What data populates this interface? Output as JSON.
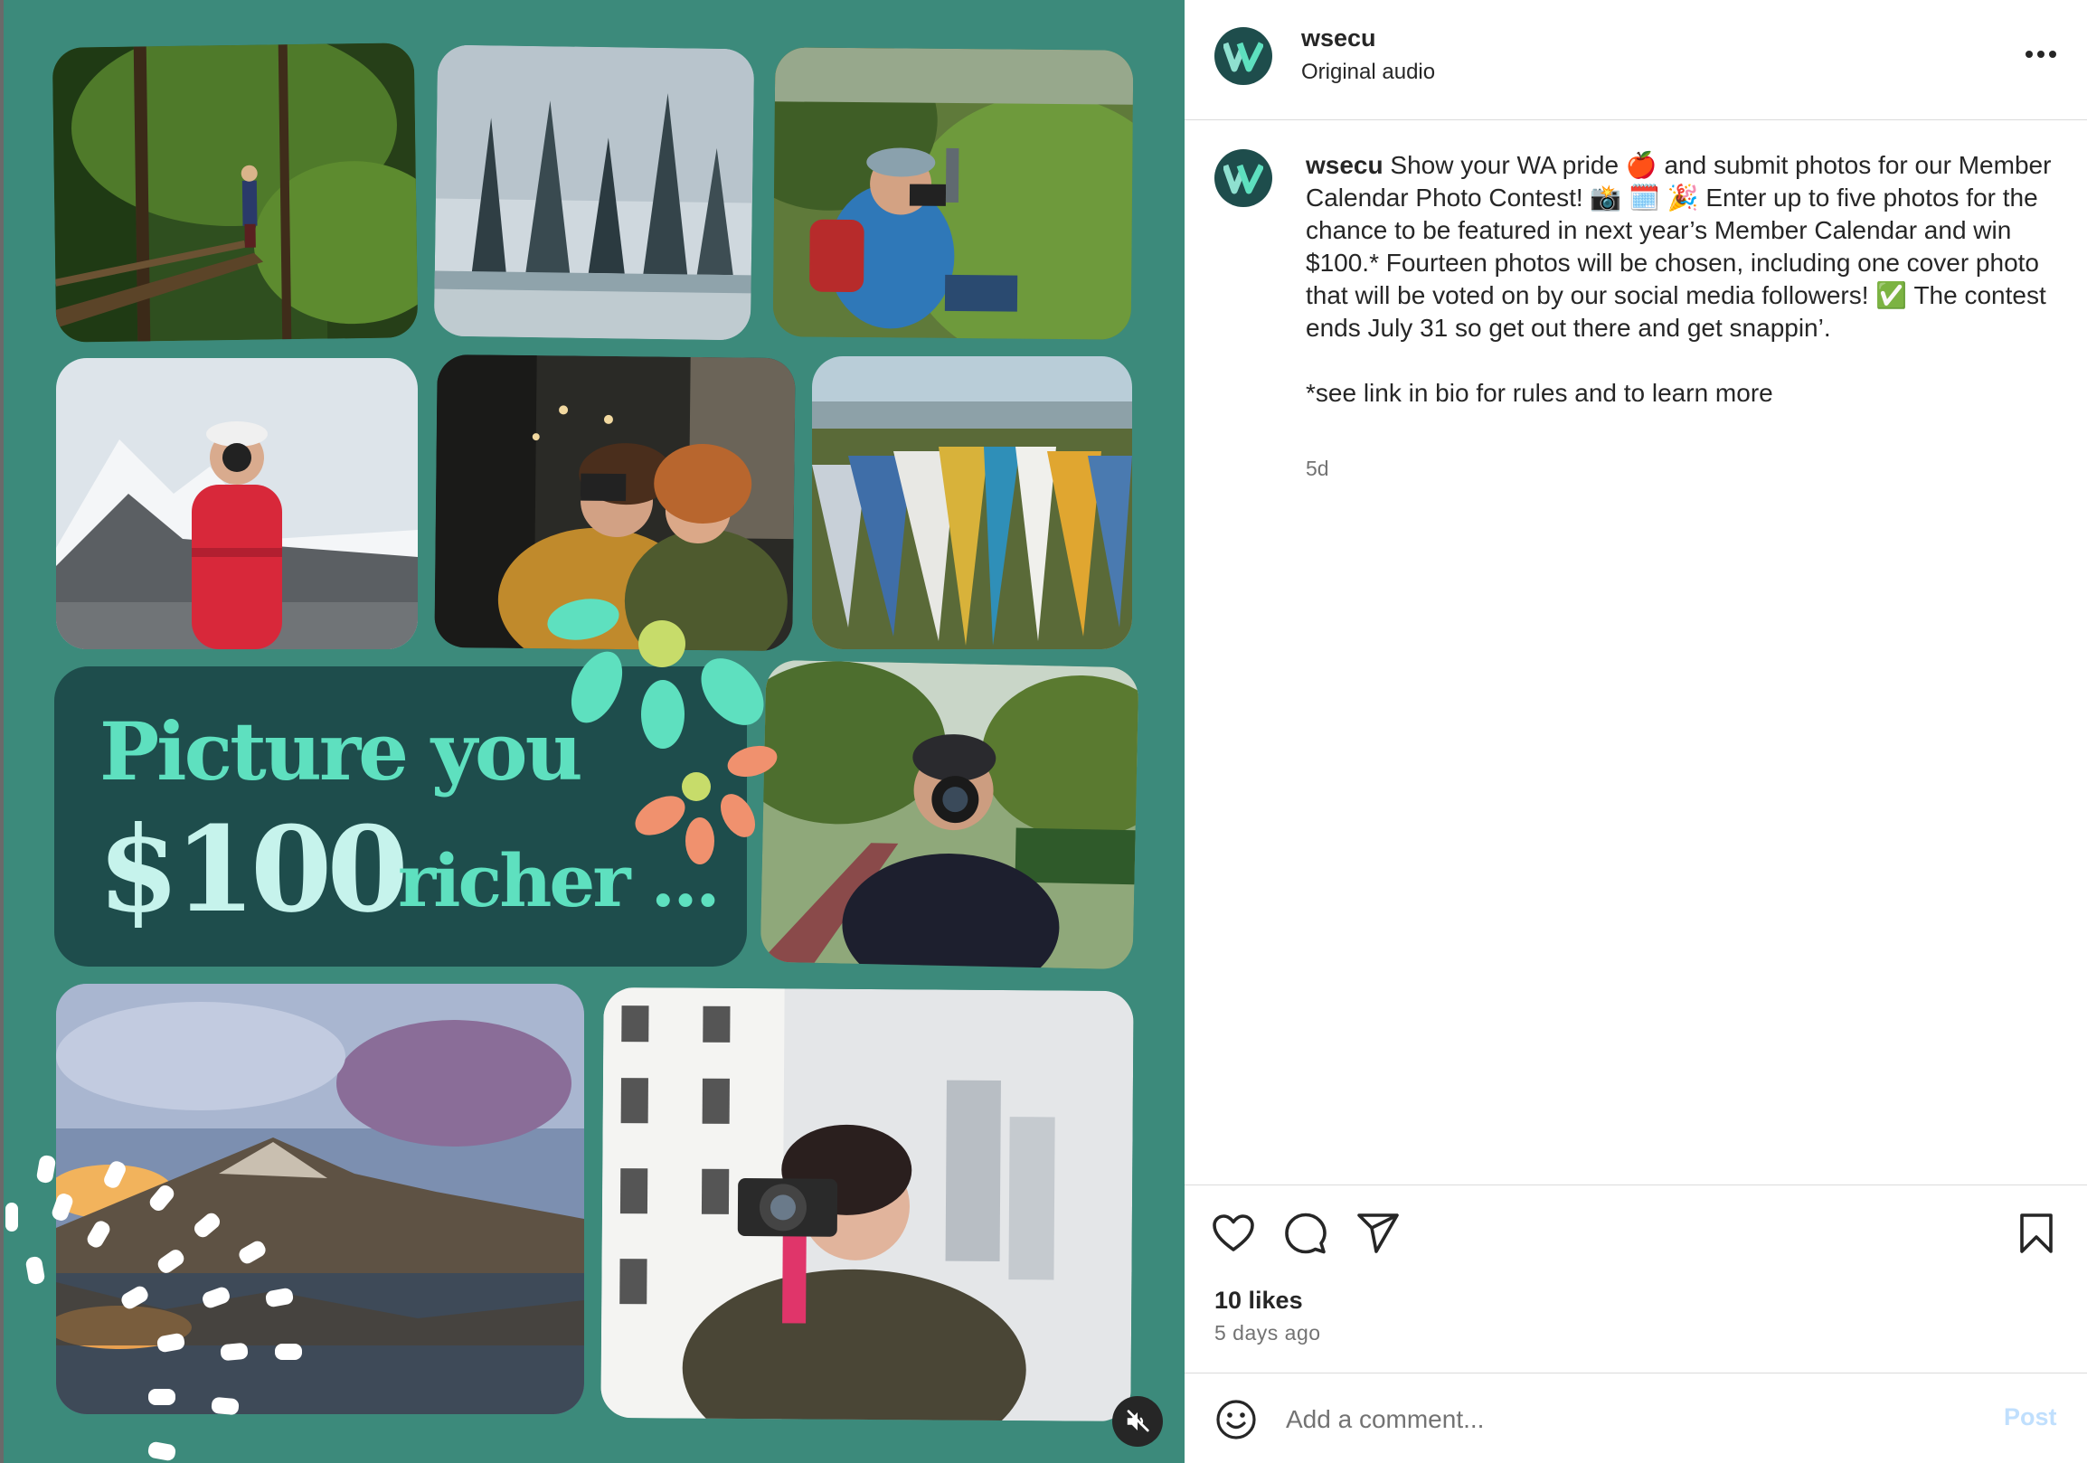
{
  "post": {
    "username": "wsecu",
    "audio": "Original audio",
    "avatar_letter": "W"
  },
  "media": {
    "headline_line1": "Picture you",
    "headline_amount": "$100",
    "headline_line2": "richer ...",
    "photos": [
      "forest-trail-photo",
      "snowy-lake-photo",
      "hiker-camera-photo",
      "mountain-camera-photo",
      "friends-camera-photo",
      "kayaks-photo",
      "path-camera-photo",
      "mountain-lake-photo",
      "city-camera-photo"
    ],
    "colors": {
      "background": "#3c8a7b",
      "headline_bg": "#1e4d4c",
      "headline_text": "#5ee0bf",
      "amount_text": "#c6f3ec"
    }
  },
  "caption": {
    "username": "wsecu",
    "text": "Show your WA pride 🍎 and submit photos for our Member Calendar Photo Contest! 📸 🗓️ 🎉 Enter up to five photos for the chance to be featured in next year’s Member Calendar and win $100.* Fourteen photos will be chosen, including one cover photo that will be voted on by our social media followers! ✅ The contest ends July 31 so get out there and get snappin’.",
    "note": "*see link in bio for rules and to learn more",
    "age": "5d"
  },
  "actions": {
    "icons": [
      "heart-icon",
      "comment-icon",
      "share-icon",
      "bookmark-icon"
    ]
  },
  "stats": {
    "likes": "10 likes",
    "posted": "5 days ago"
  },
  "comment": {
    "placeholder": "Add a comment...",
    "post_label": "Post"
  }
}
